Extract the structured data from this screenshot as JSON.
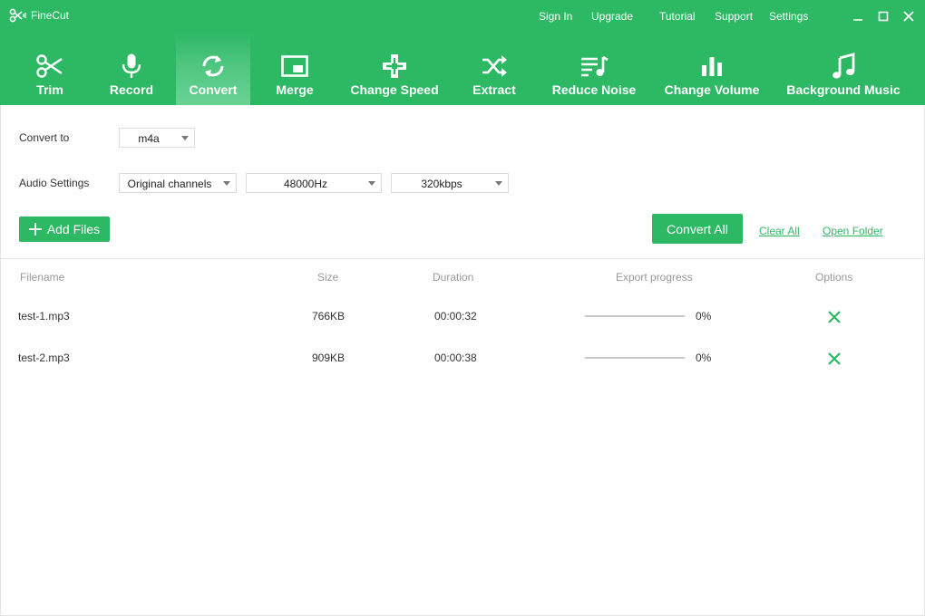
{
  "app": {
    "title": "FineCut"
  },
  "top_links": [
    "Sign In",
    "Upgrade",
    "Tutorial",
    "Support",
    "Settings"
  ],
  "window_controls": [
    "minimize-icon",
    "maximize-icon",
    "close-icon"
  ],
  "toolbar": {
    "items": [
      {
        "label": "Trim",
        "icon": "scissors-icon"
      },
      {
        "label": "Record",
        "icon": "microphone-icon"
      },
      {
        "label": "Convert",
        "icon": "convert-icon",
        "active": true
      },
      {
        "label": "Merge",
        "icon": "merge-icon"
      },
      {
        "label": "Change Speed",
        "icon": "gamepad-icon"
      },
      {
        "label": "Extract",
        "icon": "shuffle-icon"
      },
      {
        "label": "Reduce Noise",
        "icon": "noise-icon"
      },
      {
        "label": "Change Volume",
        "icon": "volume-bars-icon"
      },
      {
        "label": "Background Music",
        "icon": "music-note-icon"
      }
    ]
  },
  "convert": {
    "convert_to_label": "Convert to",
    "format_value": "m4a",
    "audio_settings_label": "Audio Settings",
    "channels_value": "Original channels",
    "sample_rate_value": "48000Hz",
    "bitrate_value": "320kbps"
  },
  "actions": {
    "add_files": "Add Files",
    "convert_all": "Convert All",
    "clear_all": "Clear All",
    "open_folder": "Open Folder"
  },
  "table": {
    "headers": {
      "filename": "Filename",
      "size": "Size",
      "duration": "Duration",
      "progress": "Export progress",
      "options": "Options"
    },
    "rows": [
      {
        "filename": "test-1.mp3",
        "size": "766KB",
        "duration": "00:00:32",
        "progress": 0,
        "progress_text": "0%"
      },
      {
        "filename": "test-2.mp3",
        "size": "909KB",
        "duration": "00:00:38",
        "progress": 0,
        "progress_text": "0%"
      }
    ]
  },
  "colors": {
    "accent": "#2db864",
    "header_text": "#999999"
  }
}
